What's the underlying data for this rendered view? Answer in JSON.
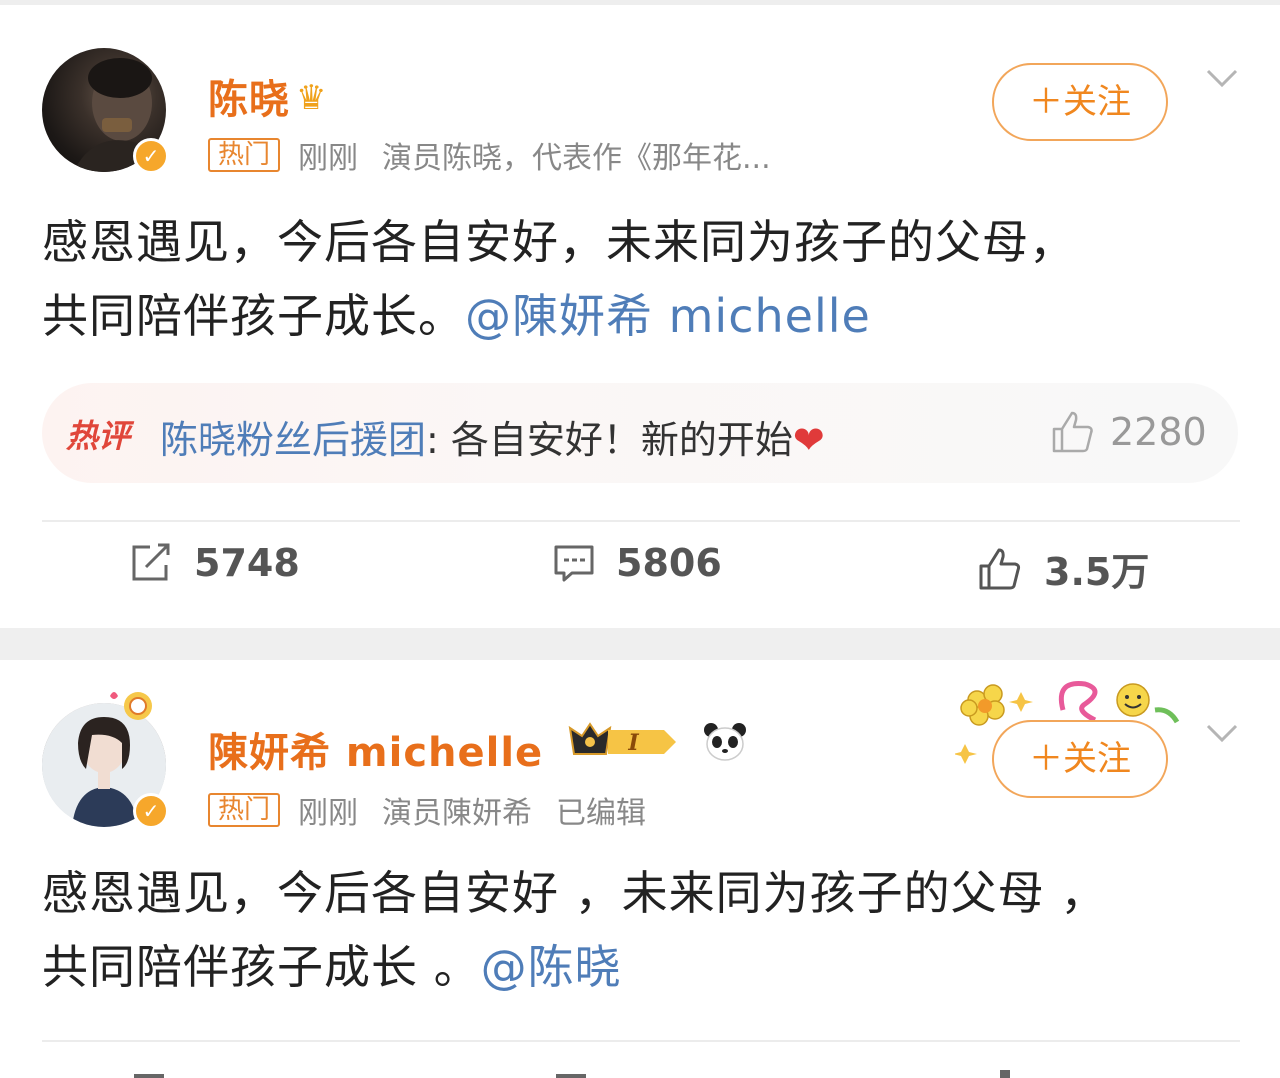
{
  "posts": [
    {
      "username": "陈晓",
      "hot_tag": "热门",
      "time": "刚刚",
      "bio": "演员陈晓，代表作《那年花...",
      "follow_label": "＋关注",
      "text_line1": "感恩遇见，今后各自安好，未来同为孩子的父母，",
      "text_line2": "共同陪伴孩子成长。",
      "mention": "@陳妍希 michelle",
      "hot_comment": {
        "tag": "热评",
        "user": "陈晓粉丝后援团",
        "text": ": 各自安好！新的开始",
        "emoji": "❤",
        "likes": "2280"
      },
      "actions": {
        "reposts": "5748",
        "comments": "5806",
        "likes": "3.5万"
      }
    },
    {
      "username": "陳妍希 michelle",
      "level_badge": "I",
      "hot_tag": "热门",
      "time": "刚刚",
      "bio": "演员陳妍希",
      "edited": "已编辑",
      "follow_label": "＋关注",
      "text_line1": "感恩遇见，今后各自安好 ，未来同为孩子的父母 ，",
      "text_line2": "共同陪伴孩子成长 。",
      "mention": "@陈晓"
    }
  ],
  "colors": {
    "username": "#e86f1b",
    "mention": "#4f7db8",
    "follow": "#f0871f",
    "hot_comment_tag": "#e0463a"
  }
}
